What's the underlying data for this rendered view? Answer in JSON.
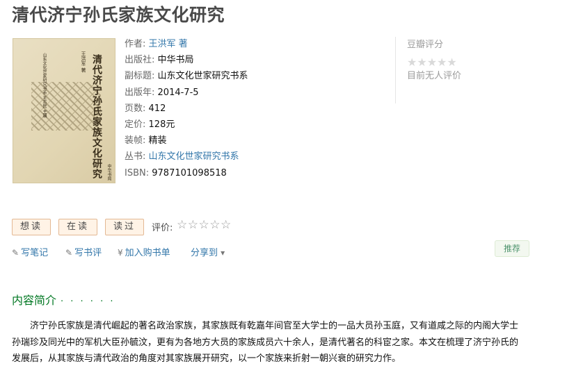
{
  "title": "清代济宁孙氏家族文化研究",
  "cover": {
    "title_text": "清代济宁孙氏家族文化研究",
    "author_text": "王洪军 著",
    "series_text": "山东文化世家研究书系 王志民 主编",
    "publisher_text": "中华书局"
  },
  "info": {
    "author_label": "作者:",
    "author": "王洪军 著",
    "publisher_label": "出版社:",
    "publisher": "中华书局",
    "subtitle_label": "副标题:",
    "subtitle": "山东文化世家研究书系",
    "pubyear_label": "出版年:",
    "pubyear": "2014-7-5",
    "pages_label": "页数:",
    "pages": "412",
    "price_label": "定价:",
    "price": "128元",
    "binding_label": "装帧:",
    "binding": "精装",
    "series_label": "丛书:",
    "series": "山东文化世家研究书系",
    "isbn_label": "ISBN:",
    "isbn": "9787101098518"
  },
  "rating": {
    "label": "豆瓣评分",
    "stars": "★★★★★",
    "none_text": "目前无人评价"
  },
  "buttons": {
    "want": "想读",
    "reading": "在读",
    "read": "读过"
  },
  "rate": {
    "label": "评价:",
    "stars": "☆☆☆☆☆"
  },
  "actions": {
    "note": "写笔记",
    "review": "写书评",
    "cart": "加入购书单",
    "share": "分享到",
    "pencil": "✎",
    "yen": "¥",
    "caret": "▾"
  },
  "recommend": "推荐",
  "section": {
    "title": "内容简介",
    "dots": "· · · · · ·"
  },
  "intro": "济宁孙氏家族是清代崛起的著名政治家族，其家族既有乾嘉年间官至大学士的一品大员孙玉庭，又有道咸之际的内阁大学士孙瑞珍及同光中的军机大臣孙毓汶，更有为各地方大员的家族成员六十余人，是清代著名的科宦之家。本文在梳理了济宁孙氏的发展后，从其家族与清代政治的角度对其家族展开研究，以一个家族来折射一朝兴衰的研究力作。"
}
